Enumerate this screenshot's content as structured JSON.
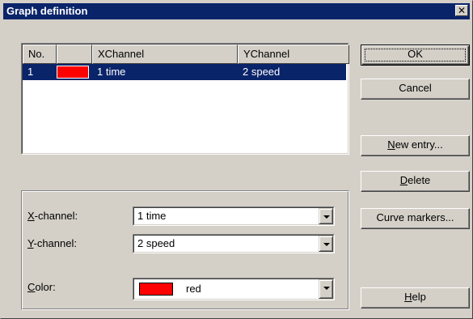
{
  "dialog": {
    "title": "Graph definition",
    "close_label": "✕"
  },
  "list": {
    "headers": {
      "no": "No.",
      "color": "",
      "xchannel": "XChannel",
      "ychannel": "YChannel"
    },
    "rows": [
      {
        "no": "1",
        "color": "#ff0000",
        "xchannel": "1  time",
        "ychannel": "2  speed",
        "selected": true
      }
    ]
  },
  "form": {
    "xchannel_label_prefix": "X",
    "xchannel_label_rest": "-channel:",
    "xchannel_value": "1  time",
    "ychannel_label_prefix": "Y",
    "ychannel_label_rest": "-channel:",
    "ychannel_value": "2  speed",
    "color_label_prefix": "C",
    "color_label_rest": "olor:",
    "color_value": "red",
    "color_swatch": "#ff0000"
  },
  "buttons": {
    "ok": "OK",
    "cancel": "Cancel",
    "new_entry_prefix": "N",
    "new_entry_rest": "ew entry...",
    "delete_prefix": "D",
    "delete_rest": "elete",
    "curve_markers": "Curve markers...",
    "help_prefix": "H",
    "help_rest": "elp"
  },
  "colors": {
    "selection": "#0a246a",
    "titlebar": "#0a246a",
    "face": "#d4d0c8",
    "swatch_red": "#ff0000"
  }
}
